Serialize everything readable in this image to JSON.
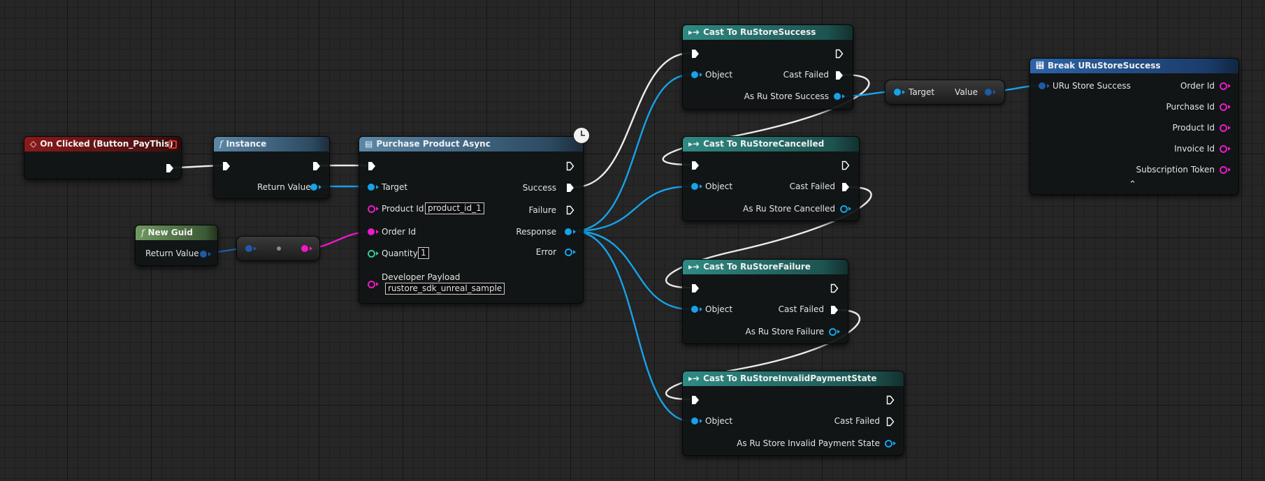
{
  "colors": {
    "exec": "#ffffff",
    "object_pin": "#16a3ea",
    "string_pin": "#f018c8",
    "int_pin": "#2ecaa0",
    "event_header": "#8b1a1a",
    "function_header": "#5c88a8",
    "pure_header": "#6f9a60",
    "cast_header": "#2f8a84",
    "break_header": "#2c64a8"
  },
  "icons": {
    "event": "diamond-event-icon",
    "function": "function-f-icon",
    "async": "async-action-icon",
    "cast": "cast-arrow-icon",
    "break": "break-struct-icon",
    "latent": "clock-icon"
  },
  "nodes": {
    "on_clicked": {
      "title": "On Clicked (Button_PayThis)"
    },
    "instance": {
      "title": "Instance",
      "return_value": "Return Value"
    },
    "new_guid": {
      "title": "New Guid",
      "return_value": "Return Value"
    },
    "purchase": {
      "title": "Purchase Product Async",
      "target": "Target",
      "product_id": "Product Id",
      "product_id_value": "product_id_1",
      "order_id": "Order Id",
      "quantity": "Quantity",
      "quantity_value": "1",
      "developer_payload": "Developer Payload",
      "developer_payload_value": "rustore_sdk_unreal_sample",
      "success": "Success",
      "failure": "Failure",
      "response": "Response",
      "error": "Error"
    },
    "cast_success": {
      "title": "Cast To RuStoreSuccess",
      "object": "Object",
      "cast_failed": "Cast Failed",
      "as": "As Ru Store Success"
    },
    "cast_cancelled": {
      "title": "Cast To RuStoreCancelled",
      "object": "Object",
      "cast_failed": "Cast Failed",
      "as": "As Ru Store Cancelled"
    },
    "cast_failure": {
      "title": "Cast To RuStoreFailure",
      "object": "Object",
      "cast_failed": "Cast Failed",
      "as": "As Ru Store Failure"
    },
    "cast_invalid": {
      "title": "Cast To RuStoreInvalidPaymentState",
      "object": "Object",
      "cast_failed": "Cast Failed",
      "as": "As Ru Store Invalid Payment State"
    },
    "target_value": {
      "target": "Target",
      "value": "Value"
    },
    "break": {
      "title": "Break URuStoreSuccess",
      "input": "URu Store Success",
      "outputs": [
        "Order Id",
        "Purchase Id",
        "Product Id",
        "Invoice Id",
        "Subscription Token"
      ]
    }
  }
}
